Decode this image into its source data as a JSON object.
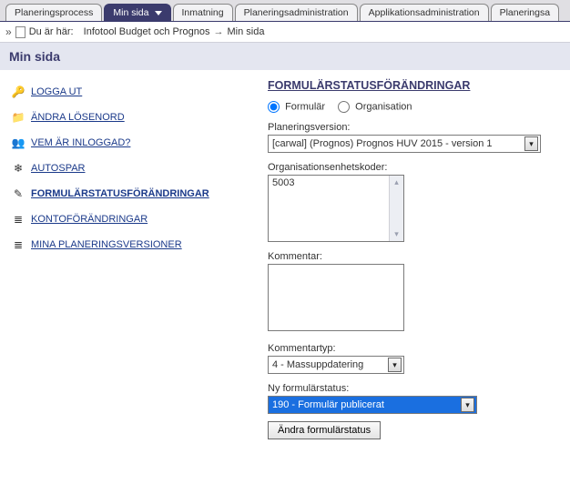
{
  "tabs": [
    {
      "label": "Planeringsprocess",
      "active": false
    },
    {
      "label": "Min sida",
      "active": true
    },
    {
      "label": "Inmatning",
      "active": false
    },
    {
      "label": "Planeringsadministration",
      "active": false
    },
    {
      "label": "Applikationsadministration",
      "active": false
    },
    {
      "label": "Planeringsa",
      "active": false
    }
  ],
  "breadcrumb": {
    "prefix": "Du är här:",
    "root": "Infotool Budget och Prognos",
    "current": "Min sida"
  },
  "page_title": "Min sida",
  "sidebar": {
    "items": [
      {
        "label": "LOGGA UT",
        "icon": "🔑",
        "active": false
      },
      {
        "label": "ÄNDRA LÖSENORD",
        "icon": "📁",
        "active": false
      },
      {
        "label": "VEM ÄR INLOGGAD?",
        "icon": "👥",
        "active": false
      },
      {
        "label": "AUTOSPAR",
        "icon": "❄",
        "active": false
      },
      {
        "label": "FORMULÄRSTATUSFÖRÄNDRINGAR",
        "icon": "✎",
        "active": true
      },
      {
        "label": "KONTOFÖRÄNDRINGAR",
        "icon": "≣",
        "active": false
      },
      {
        "label": "MINA PLANERINGSVERSIONER",
        "icon": "≣",
        "active": false
      }
    ]
  },
  "form": {
    "heading": "FORMULÄRSTATUSFÖRÄNDRINGAR",
    "radio": {
      "option1": "Formulär",
      "option2": "Organisation",
      "selected": "option1"
    },
    "planversion_label": "Planeringsversion:",
    "planversion_value": "[carwal] (Prognos) Prognos HUV 2015 - version 1",
    "orgcodes_label": "Organisationsenhetskoder:",
    "orgcodes_value": "5003",
    "comment_label": "Kommentar:",
    "comment_value": "",
    "commenttype_label": "Kommentartyp:",
    "commenttype_value": "4 - Massuppdatering",
    "newstatus_label": "Ny formulärstatus:",
    "newstatus_value": "190 - Formulär publicerat",
    "submit_label": "Ändra formulärstatus"
  }
}
